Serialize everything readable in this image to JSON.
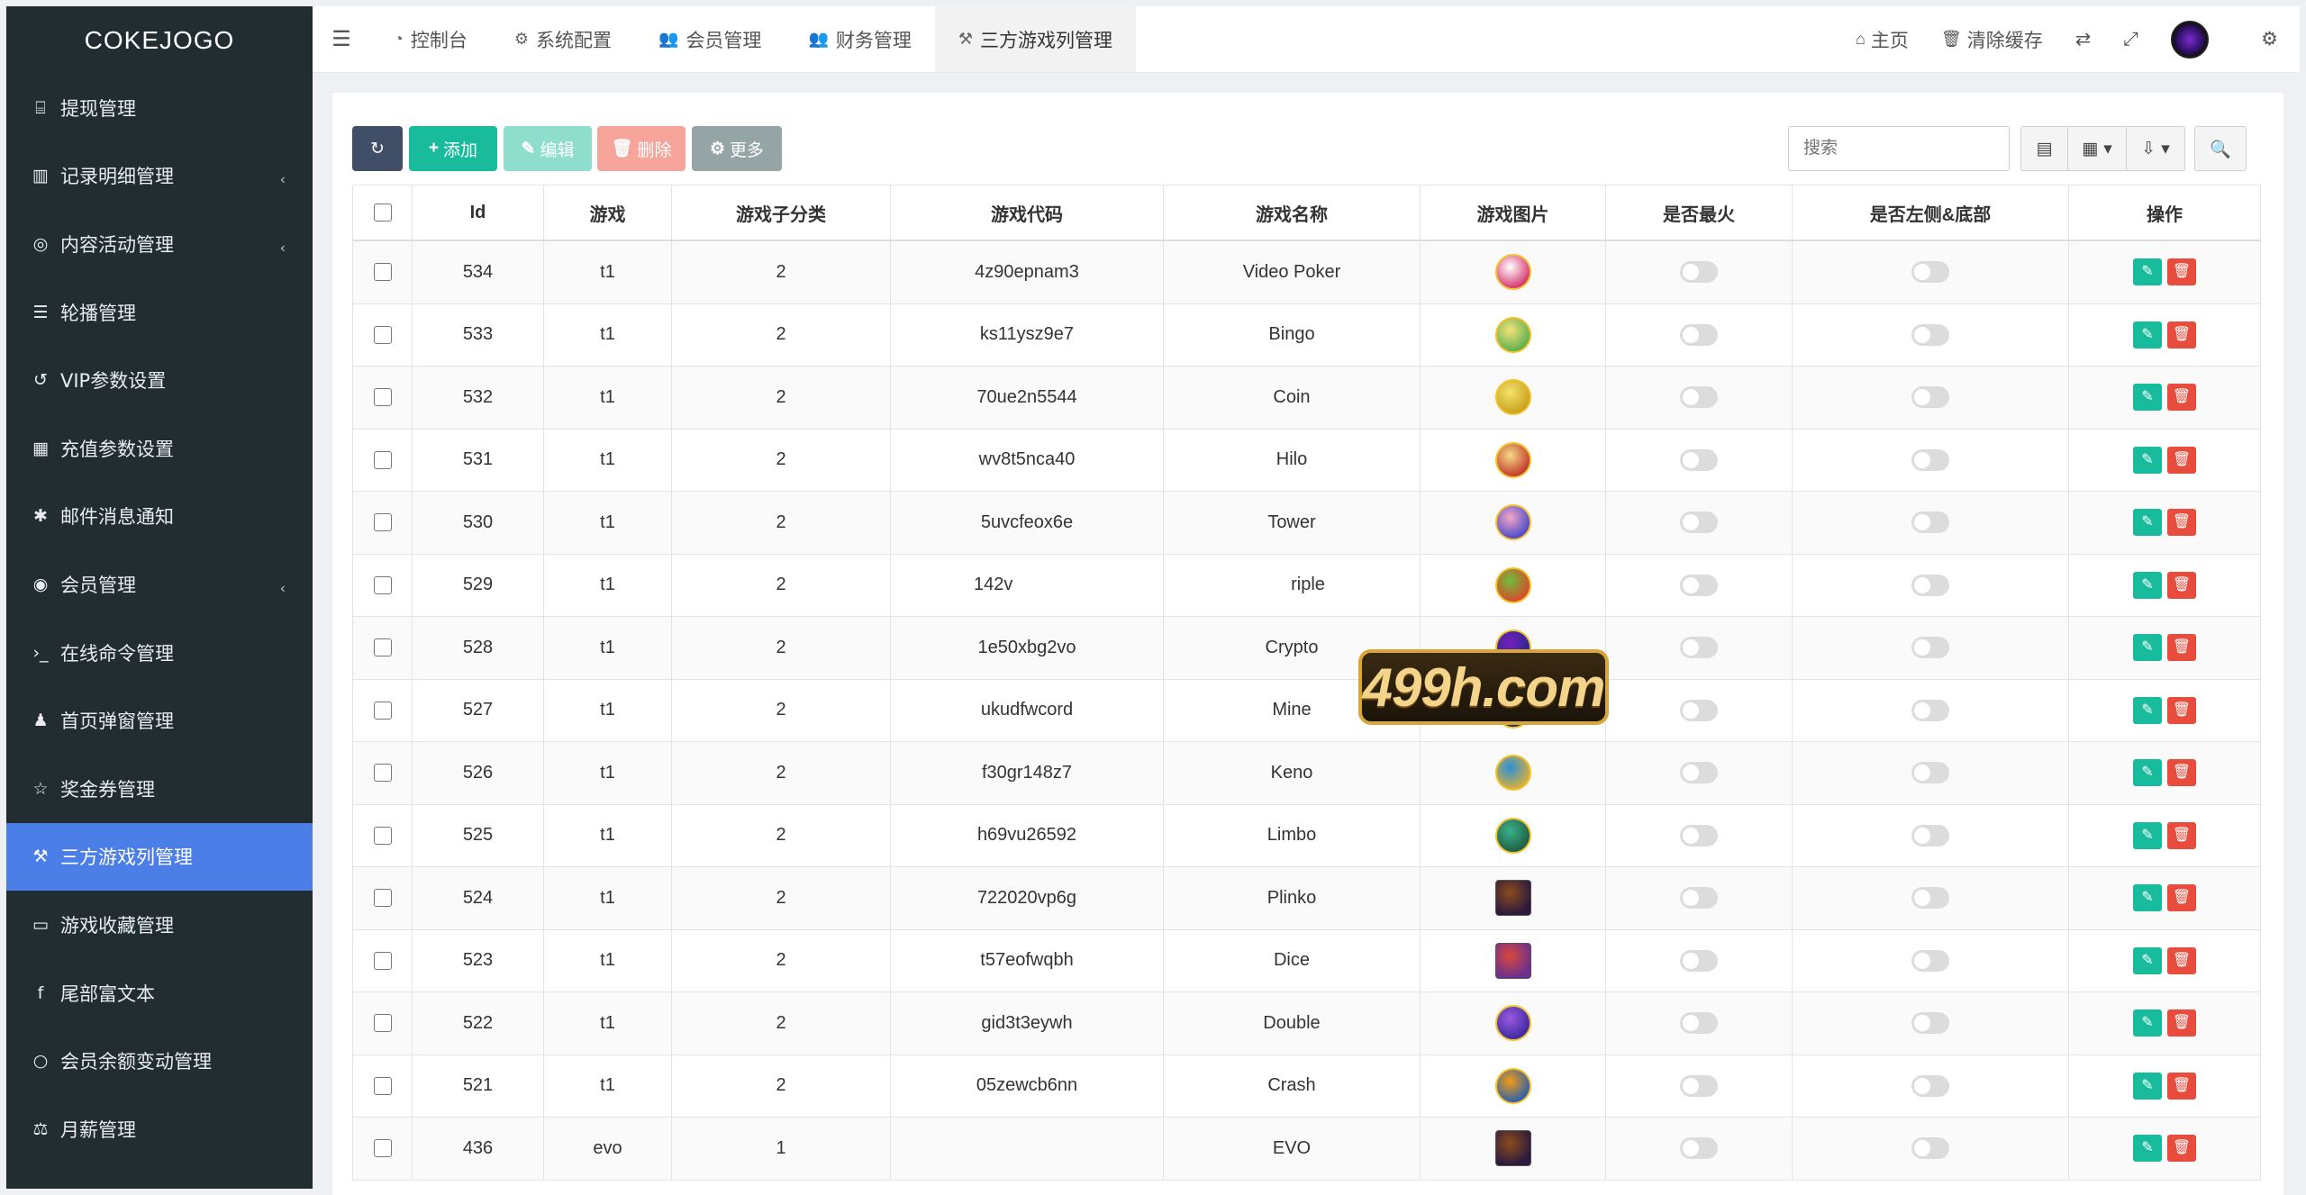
{
  "brand": "COKEJOGO",
  "sidebar": {
    "items": [
      {
        "label": "提现管理",
        "icon": "bank-icon",
        "glyph": "⌸",
        "has_arrow": false,
        "active": false
      },
      {
        "label": "记录明细管理",
        "icon": "bar-chart-icon",
        "glyph": "▥",
        "has_arrow": true,
        "active": false
      },
      {
        "label": "内容活动管理",
        "icon": "chrome-icon",
        "glyph": "◎",
        "has_arrow": true,
        "active": false
      },
      {
        "label": "轮播管理",
        "icon": "bars-icon",
        "glyph": "☰",
        "has_arrow": false,
        "active": false
      },
      {
        "label": "VIP参数设置",
        "icon": "history-icon",
        "glyph": "↺",
        "has_arrow": false,
        "active": false
      },
      {
        "label": "充值参数设置",
        "icon": "grid-icon",
        "glyph": "▦",
        "has_arrow": false,
        "active": false
      },
      {
        "label": "邮件消息通知",
        "icon": "asterisk-icon",
        "glyph": "✱",
        "has_arrow": false,
        "active": false
      },
      {
        "label": "会员管理",
        "icon": "user-circle-icon",
        "glyph": "◉",
        "has_arrow": true,
        "active": false
      },
      {
        "label": "在线命令管理",
        "icon": "terminal-icon",
        "glyph": "›_",
        "has_arrow": false,
        "active": false
      },
      {
        "label": "首页弹窗管理",
        "icon": "bell-icon",
        "glyph": "♟",
        "has_arrow": false,
        "active": false
      },
      {
        "label": "奖金券管理",
        "icon": "star-icon",
        "glyph": "☆",
        "has_arrow": false,
        "active": false
      },
      {
        "label": "三方游戏列管理",
        "icon": "gavel-icon",
        "glyph": "⚒",
        "has_arrow": false,
        "active": true
      },
      {
        "label": "游戏收藏管理",
        "icon": "folder-open-icon",
        "glyph": "▭",
        "has_arrow": false,
        "active": false
      },
      {
        "label": "尾部富文本",
        "icon": "facebook-icon",
        "glyph": "f",
        "has_arrow": false,
        "active": false
      },
      {
        "label": "会员余额变动管理",
        "icon": "circle-icon",
        "glyph": "○",
        "has_arrow": false,
        "active": false
      },
      {
        "label": "月薪管理",
        "icon": "balance-scale-icon",
        "glyph": "⚖",
        "has_arrow": false,
        "active": false
      }
    ],
    "arrow_glyph": "‹"
  },
  "topbar": {
    "toggle_glyph": "☰",
    "tabs": [
      {
        "label": "控制台",
        "glyph": "◔",
        "icon": "dashboard-icon",
        "active": false
      },
      {
        "label": "系统配置",
        "glyph": "⚙",
        "icon": "cog-icon",
        "active": false
      },
      {
        "label": "会员管理",
        "glyph": "👥",
        "icon": "users-icon",
        "active": false
      },
      {
        "label": "财务管理",
        "glyph": "👥",
        "icon": "users-icon",
        "active": false
      },
      {
        "label": "三方游戏列管理",
        "glyph": "⚒",
        "icon": "gavel-icon",
        "active": true
      }
    ],
    "home_label": "主页",
    "home_glyph": "⌂",
    "clear_cache_label": "清除缓存",
    "clear_cache_glyph": "🗑",
    "translate_glyph": "⇄",
    "fullscreen_glyph": "⤢",
    "settings_glyph": "⚙"
  },
  "toolbar": {
    "refresh_glyph": "↻",
    "add_label": "添加",
    "add_glyph": "+",
    "edit_label": "编辑",
    "edit_glyph": "✎",
    "delete_label": "删除",
    "delete_glyph": "🗑",
    "more_label": "更多",
    "more_glyph": "⚙",
    "search_placeholder": "搜索",
    "list_glyph": "▤",
    "cols_glyph": "▦ ▾",
    "export_glyph": "⇩ ▾",
    "search_glyph": "🔍"
  },
  "table": {
    "columns": [
      "Id",
      "游戏",
      "游戏子分类",
      "游戏代码",
      "游戏名称",
      "游戏图片",
      "是否最火",
      "是否左侧&底部",
      "操作"
    ],
    "rows": [
      {
        "id": "534",
        "game": "t1",
        "sub": "2",
        "code": "4z90epnam3",
        "name": "Video Poker",
        "img_colors": [
          "#ffffff",
          "#d6336c"
        ],
        "img_style": "circle"
      },
      {
        "id": "533",
        "game": "t1",
        "sub": "2",
        "code": "ks11ysz9e7",
        "name": "Bingo",
        "img_colors": [
          "#f6e27a",
          "#5bb04c"
        ],
        "img_style": "circle"
      },
      {
        "id": "532",
        "game": "t1",
        "sub": "2",
        "code": "70ue2n5544",
        "name": "Coin",
        "img_colors": [
          "#f2e36a",
          "#caa21c"
        ],
        "img_style": "circle"
      },
      {
        "id": "531",
        "game": "t1",
        "sub": "2",
        "code": "wv8t5nca40",
        "name": "Hilo",
        "img_colors": [
          "#f5d987",
          "#c0392b"
        ],
        "img_style": "circle"
      },
      {
        "id": "530",
        "game": "t1",
        "sub": "2",
        "code": "5uvcfeox6e",
        "name": "Tower",
        "img_colors": [
          "#f3a6c4",
          "#4a4ac9"
        ],
        "img_style": "circle"
      },
      {
        "id": "529",
        "game": "t1",
        "sub": "2",
        "code": "142v",
        "name": "riple",
        "img_colors": [
          "#6ebd3a",
          "#d94a2a"
        ],
        "img_style": "circle"
      },
      {
        "id": "528",
        "game": "t1",
        "sub": "2",
        "code": "1e50xbg2vo",
        "name": "Crypto",
        "img_colors": [
          "#7a1fbf",
          "#1f2a8c"
        ],
        "img_style": "circle"
      },
      {
        "id": "527",
        "game": "t1",
        "sub": "2",
        "code": "ukudfwcord",
        "name": "Mine",
        "img_colors": [
          "#3da0e6",
          "#17306b"
        ],
        "img_style": "circle"
      },
      {
        "id": "526",
        "game": "t1",
        "sub": "2",
        "code": "f30gr148z7",
        "name": "Keno",
        "img_colors": [
          "#2c8fd6",
          "#d9b13c"
        ],
        "img_style": "circle"
      },
      {
        "id": "525",
        "game": "t1",
        "sub": "2",
        "code": "h69vu26592",
        "name": "Limbo",
        "img_colors": [
          "#3bb08a",
          "#1f5e44"
        ],
        "img_style": "circle"
      },
      {
        "id": "524",
        "game": "t1",
        "sub": "2",
        "code": "722020vp6g",
        "name": "Plinko",
        "img_colors": [
          "#8b4b1c",
          "#2b1a3d"
        ],
        "img_style": "square"
      },
      {
        "id": "523",
        "game": "t1",
        "sub": "2",
        "code": "t57eofwqbh",
        "name": "Dice",
        "img_colors": [
          "#d9483b",
          "#6b2f8f"
        ],
        "img_style": "square"
      },
      {
        "id": "522",
        "game": "t1",
        "sub": "2",
        "code": "gid3t3eywh",
        "name": "Double",
        "img_colors": [
          "#9b59e0",
          "#3a2aa0"
        ],
        "img_style": "circle"
      },
      {
        "id": "521",
        "game": "t1",
        "sub": "2",
        "code": "05zewcb6nn",
        "name": "Crash",
        "img_colors": [
          "#f39c12",
          "#2a5fb0"
        ],
        "img_style": "circle"
      },
      {
        "id": "436",
        "game": "evo",
        "sub": "1",
        "code": "",
        "name": "EVO",
        "img_colors": [
          "#8b4b1c",
          "#2b1a3d"
        ],
        "img_style": "square"
      }
    ],
    "edit_glyph": "✎",
    "delete_glyph": "🗑"
  },
  "watermark": "499h.com"
}
